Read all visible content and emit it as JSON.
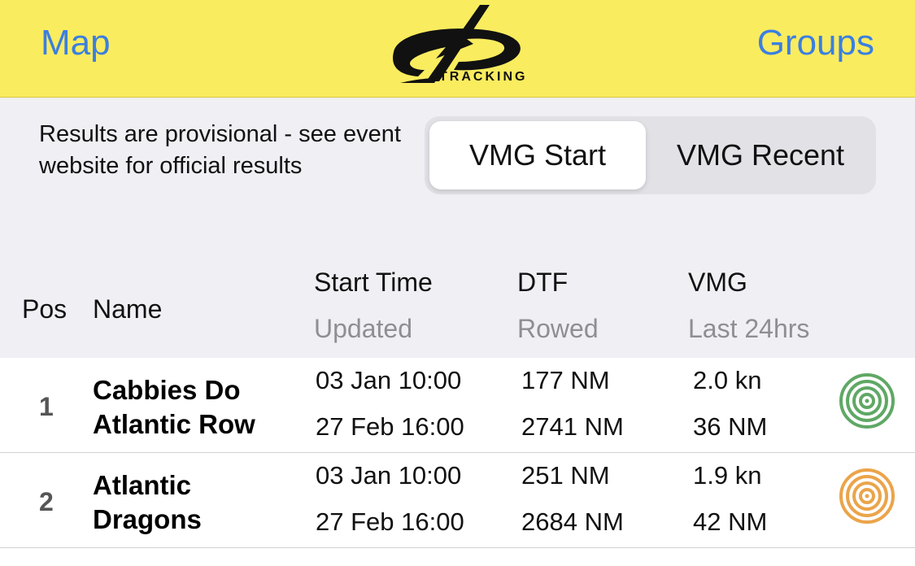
{
  "navbar": {
    "left_label": "Map",
    "right_label": "Groups",
    "logo_text": "TRACKING"
  },
  "notice": "Results are provisional - see event website for official results",
  "segmented": {
    "options": [
      "VMG Start",
      "VMG Recent"
    ],
    "selected": "VMG Start"
  },
  "table": {
    "headers": {
      "pos": "Pos",
      "name": "Name",
      "start_time": "Start Time",
      "updated": "Updated",
      "dtf": "DTF",
      "rowed": "Rowed",
      "vmg": "VMG",
      "last24": "Last 24hrs"
    },
    "rows": [
      {
        "pos": "1",
        "name": "Cabbies Do Atlantic Row",
        "start_time": "03 Jan 10:00",
        "updated": "27 Feb 16:00",
        "dtf": "177 NM",
        "rowed": "2741 NM",
        "vmg": "2.0 kn",
        "last24": "36 NM",
        "status_icon": "target-icon-green",
        "status_color": "#5fa865"
      },
      {
        "pos": "2",
        "name": "Atlantic Dragons",
        "start_time": "03 Jan 10:00",
        "updated": "27 Feb 16:00",
        "dtf": "251 NM",
        "rowed": "2684 NM",
        "vmg": "1.9 kn",
        "last24": "42 NM",
        "status_icon": "target-icon-orange",
        "status_color": "#eba44a"
      }
    ]
  },
  "colors": {
    "navbar_bg": "#faec5f",
    "link_blue": "#3b7fe0",
    "header_bg": "#efeff4",
    "status_green": "#5fa865",
    "status_orange": "#eba44a"
  }
}
